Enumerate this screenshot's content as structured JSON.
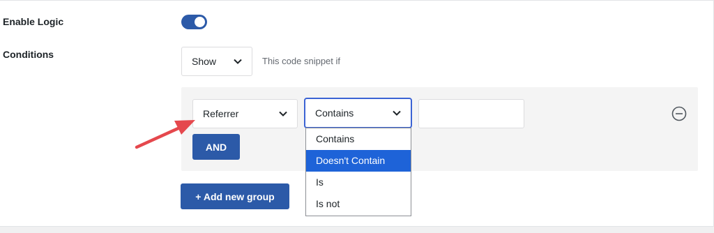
{
  "fields": {
    "enable_logic_label": "Enable Logic",
    "conditions_label": "Conditions"
  },
  "toggle": {
    "state": "on"
  },
  "visibility": {
    "selected": "Show",
    "helper_text": "This code snippet if"
  },
  "condition_row": {
    "field": "Referrer",
    "operator": "Contains",
    "value": "",
    "operator_options": [
      "Contains",
      "Doesn't Contain",
      "Is",
      "Is not"
    ],
    "highlighted_option": "Doesn't Contain"
  },
  "buttons": {
    "and": "AND",
    "add_group": "+ Add new group"
  },
  "icons": {
    "remove": "minus-circle-icon",
    "chevron": "chevron-down-icon",
    "annotation": "arrow-icon"
  },
  "colors": {
    "primary": "#2c5aa8",
    "option_highlight": "#1e63d8",
    "focus_border": "#3b63d4",
    "annotation_arrow": "#e5484d",
    "panel_bg": "#f4f4f4"
  }
}
